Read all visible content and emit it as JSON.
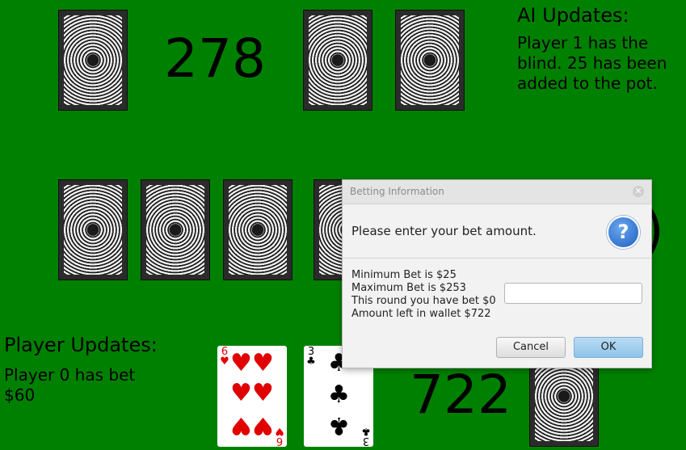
{
  "ai_pot": "278",
  "obscured_number_fragment": ")",
  "ai_updates": {
    "title": "AI Updates:",
    "message": [
      "Player 1 has the",
      "blind. 25 has been",
      "added to the pot."
    ]
  },
  "player_updates": {
    "title": "Player Updates:",
    "message": [
      "Player 0 has bet",
      "$60"
    ]
  },
  "player_wallet": "722",
  "player_hand": [
    {
      "rank": "6",
      "suit": "hearts",
      "suit_symbol": "♥",
      "color": "#e00000"
    },
    {
      "rank": "3",
      "suit": "clubs",
      "suit_symbol": "♣",
      "color": "#000000"
    }
  ],
  "dialog": {
    "title": "Betting Information",
    "close_icon": "close-icon",
    "header": "Please enter your bet amount.",
    "info_icon": "question-icon",
    "info_lines": [
      "Minimum Bet is $25",
      "Maximum Bet is $253",
      "This round you have bet $0",
      "Amount left in wallet $722"
    ],
    "bet_input": {
      "value": "",
      "placeholder": ""
    },
    "cancel_label": "Cancel",
    "ok_label": "OK"
  },
  "colors": {
    "table": "#008000",
    "hearts": "#e00000",
    "ok_button": "#8ec4ea"
  }
}
